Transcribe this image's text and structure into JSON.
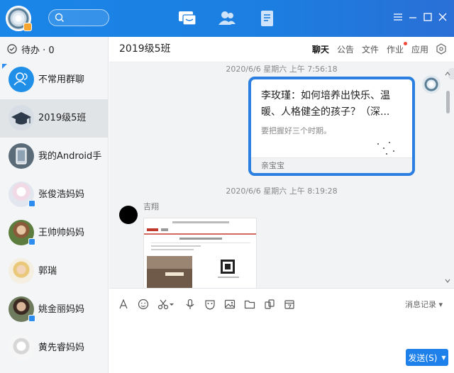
{
  "sidebar": {
    "todo_label": "待办 · 0",
    "items": [
      {
        "name": "不常用群聊"
      },
      {
        "name": "2019级5班"
      },
      {
        "name": "我的Android手"
      },
      {
        "name": "张俊浩妈妈"
      },
      {
        "name": "王帅帅妈妈"
      },
      {
        "name": "郭瑞"
      },
      {
        "name": "姚金丽妈妈"
      },
      {
        "name": "黄先睿妈妈"
      }
    ]
  },
  "chat": {
    "title": "2019级5班",
    "tabs": [
      {
        "label": "聊天"
      },
      {
        "label": "公告"
      },
      {
        "label": "文件"
      },
      {
        "label": "作业"
      },
      {
        "label": "应用"
      }
    ]
  },
  "messages": {
    "time1": "2020/6/6 星期六 上午 7:56:18",
    "card": {
      "title": "李玫瑾：如何培养出快乐、温暖、人格健全的孩子？（深...",
      "desc": "要把握好三个时期。",
      "source": "亲宝宝"
    },
    "time2": "2020/6/6 星期六 上午 8:19:28",
    "sender_name": "吉翔"
  },
  "toolbar": {
    "history_label": "消息记录"
  },
  "send_label": "发送(S)",
  "colors": {
    "titlebar": "#1c7ee0",
    "accent": "#1e80ea",
    "card_border": "#2b7fe1"
  }
}
